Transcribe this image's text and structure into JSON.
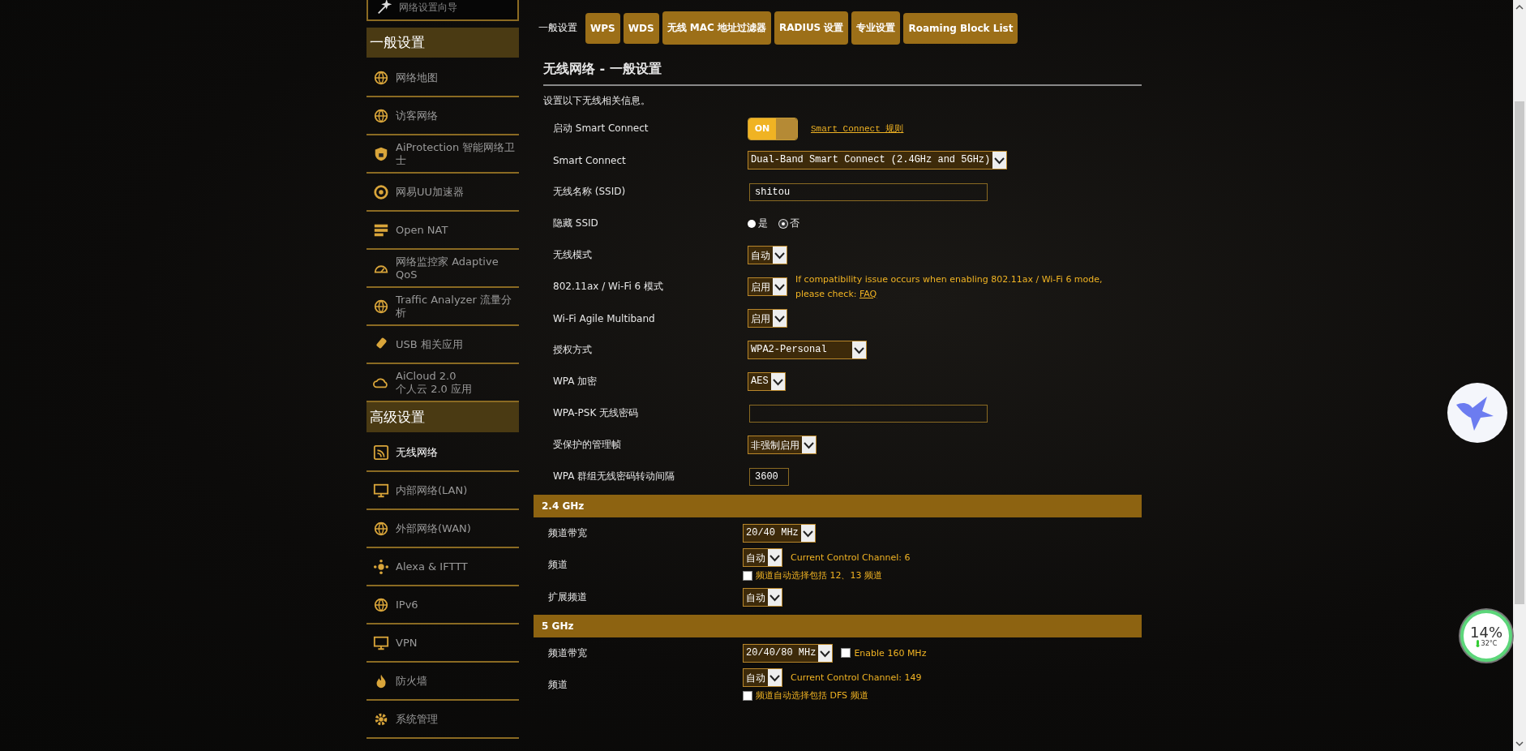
{
  "sidebar": {
    "top_item": {
      "label": "网络设置向导"
    },
    "sections": [
      {
        "title": "一般设置",
        "items": [
          {
            "label": "网络地图",
            "selected": false
          },
          {
            "label": "访客网络",
            "selected": false
          },
          {
            "label": "AiProtection 智能网络卫士",
            "selected": false
          },
          {
            "label": "网易UU加速器",
            "selected": false
          },
          {
            "label": "Open NAT",
            "selected": false
          },
          {
            "label": "网络监控家 Adaptive QoS",
            "selected": false
          },
          {
            "label": "Traffic Analyzer 流量分析",
            "selected": false
          },
          {
            "label": "USB 相关应用",
            "selected": false
          },
          {
            "label": "AiCloud 2.0\n个人云 2.0 应用",
            "selected": false
          }
        ]
      },
      {
        "title": "高级设置",
        "items": [
          {
            "label": "无线网络",
            "selected": true
          },
          {
            "label": "内部网络(LAN)",
            "selected": false
          },
          {
            "label": "外部网络(WAN)",
            "selected": false
          },
          {
            "label": "Alexa & IFTTT",
            "selected": false
          },
          {
            "label": "IPv6",
            "selected": false
          },
          {
            "label": "VPN",
            "selected": false
          },
          {
            "label": "防火墙",
            "selected": false
          },
          {
            "label": "系统管理",
            "selected": false
          }
        ]
      }
    ]
  },
  "tabs": [
    {
      "label": "一般设置",
      "selected": true
    },
    {
      "label": "WPS",
      "selected": false
    },
    {
      "label": "WDS",
      "selected": false
    },
    {
      "label": "无线 MAC 地址过滤器",
      "selected": false
    },
    {
      "label": "RADIUS 设置",
      "selected": false
    },
    {
      "label": "专业设置",
      "selected": false
    },
    {
      "label": "Roaming Block List",
      "selected": false
    }
  ],
  "page": {
    "title": "无线网络 - 一般设置",
    "description": "设置以下无线相关信息。"
  },
  "settings": [
    {
      "label": "启动 Smart Connect",
      "lines": [
        [
          {
            "kind": "toggle",
            "label": "ON",
            "on": true
          },
          {
            "kind": "link",
            "text": "Smart Connect 规则"
          }
        ]
      ]
    },
    {
      "label": "Smart Connect",
      "lines": [
        [
          {
            "kind": "select",
            "value": "Dual-Band Smart Connect (2.4GHz and 5GHz)"
          }
        ]
      ]
    },
    {
      "label": "无线名称 (SSID)",
      "lines": [
        [
          {
            "kind": "input",
            "value": "shitou"
          }
        ]
      ]
    },
    {
      "label": "隐藏 SSID",
      "lines": [
        [
          {
            "kind": "radio",
            "options": [
              {
                "label": "是",
                "selected": false
              },
              {
                "label": "否",
                "selected": true
              }
            ]
          }
        ]
      ]
    },
    {
      "label": "无线模式",
      "lines": [
        [
          {
            "kind": "select",
            "value": "自动"
          }
        ]
      ]
    },
    {
      "label": "802.11ax / Wi-Fi 6 模式",
      "lines": [
        [
          {
            "kind": "select",
            "value": "启用"
          },
          {
            "kind": "note",
            "text": "If compatibility issue occurs when enabling 802.11ax / Wi-Fi 6 mode, please check: ",
            "link": "FAQ"
          }
        ]
      ]
    },
    {
      "label": "Wi-Fi Agile Multiband",
      "lines": [
        [
          {
            "kind": "select",
            "value": "启用"
          }
        ]
      ]
    },
    {
      "label": "授权方式",
      "lines": [
        [
          {
            "kind": "select",
            "value": "WPA2-Personal    "
          }
        ]
      ]
    },
    {
      "label": "WPA 加密",
      "lines": [
        [
          {
            "kind": "select",
            "value": "AES"
          }
        ]
      ]
    },
    {
      "label": "WPA-PSK 无线密码",
      "lines": [
        [
          {
            "kind": "input"
          }
        ]
      ]
    },
    {
      "label": "受保护的管理帧",
      "lines": [
        [
          {
            "kind": "select",
            "value": "非强制启用"
          }
        ]
      ]
    },
    {
      "label": "WPA 群组无线密码转动间隔",
      "lines": [
        [
          {
            "kind": "input-small",
            "value": "3600"
          }
        ]
      ]
    }
  ],
  "bands": [
    {
      "title": "2.4 GHz",
      "settings": [
        {
          "label": "频道带宽",
          "lines": [
            [
              {
                "kind": "select",
                "value": "20/40 MHz"
              }
            ]
          ]
        },
        {
          "label": "频道",
          "lines": [
            [
              {
                "kind": "select",
                "value": "自动"
              },
              {
                "kind": "info",
                "text": "Current Control Channel: 6"
              }
            ],
            [
              {
                "kind": "checkbox",
                "label": "频道自动选择包括 12、13 频道",
                "checked": false
              }
            ]
          ]
        },
        {
          "label": "扩展频道",
          "lines": [
            [
              {
                "kind": "select",
                "value": "自动"
              }
            ]
          ]
        }
      ]
    },
    {
      "title": "5 GHz",
      "settings": [
        {
          "label": "频道带宽",
          "lines": [
            [
              {
                "kind": "select",
                "value": "20/40/80 MHz"
              },
              {
                "kind": "checkbox",
                "label": "Enable 160 MHz",
                "checked": false
              }
            ]
          ]
        },
        {
          "label": "频道",
          "lines": [
            [
              {
                "kind": "select",
                "value": "自动"
              },
              {
                "kind": "info",
                "text": "Current Control Channel: 149"
              }
            ],
            [
              {
                "kind": "checkbox",
                "label": "频道自动选择包括 DFS 频道",
                "checked": false
              }
            ]
          ]
        }
      ]
    }
  ],
  "widgets": {
    "usage": "14%",
    "temperature": "32°C"
  }
}
